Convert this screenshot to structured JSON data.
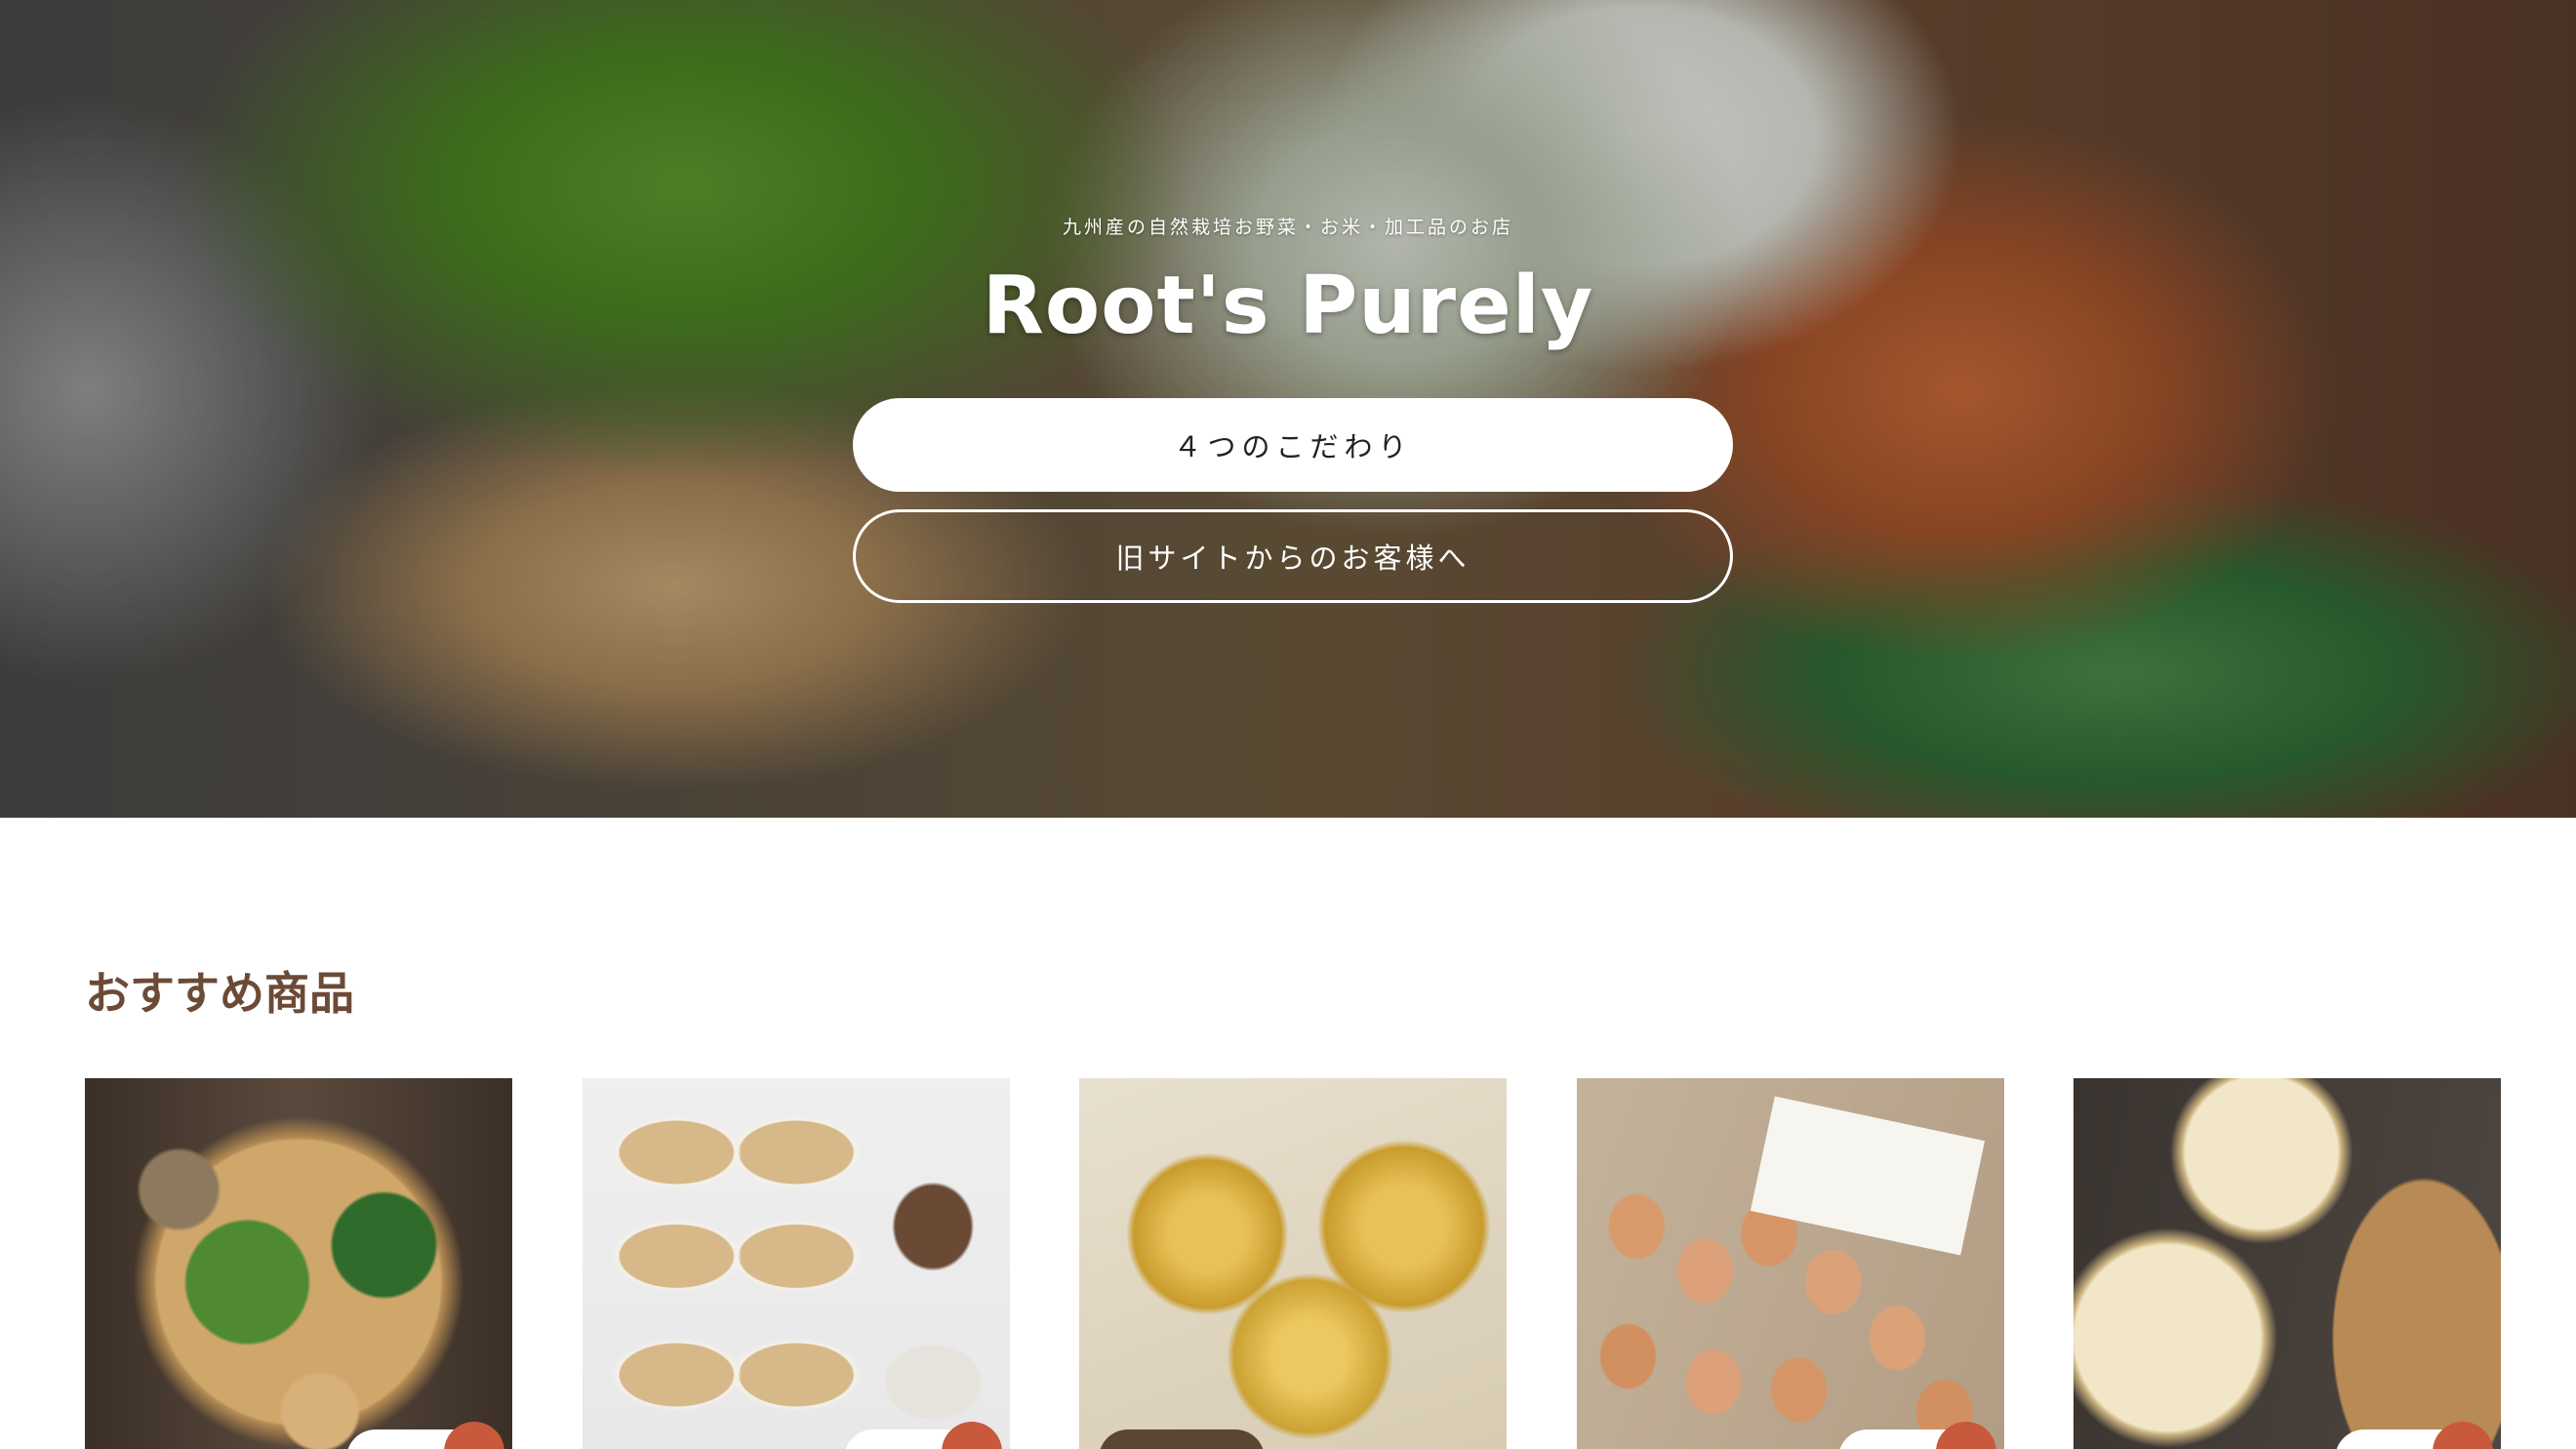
{
  "hero": {
    "subtitle": "九州産の自然栽培お野菜・お米・加工品のお店",
    "title": "Root's Purely",
    "primary_button": "４つのこだわり",
    "secondary_button": "旧サイトからのお客様へ"
  },
  "recommended": {
    "heading": "おすすめ商品",
    "products": [
      {
        "image": "vegetable-basket-photo"
      },
      {
        "image": "purely-packaged-foods-photo"
      },
      {
        "image": "pears-photo"
      },
      {
        "image": "eggs-in-carton-photo"
      },
      {
        "image": "lotus-root-photo"
      }
    ]
  },
  "colors": {
    "heading": "#6b4a37",
    "accent": "#c8593c",
    "dark_badge": "#5b4634"
  }
}
